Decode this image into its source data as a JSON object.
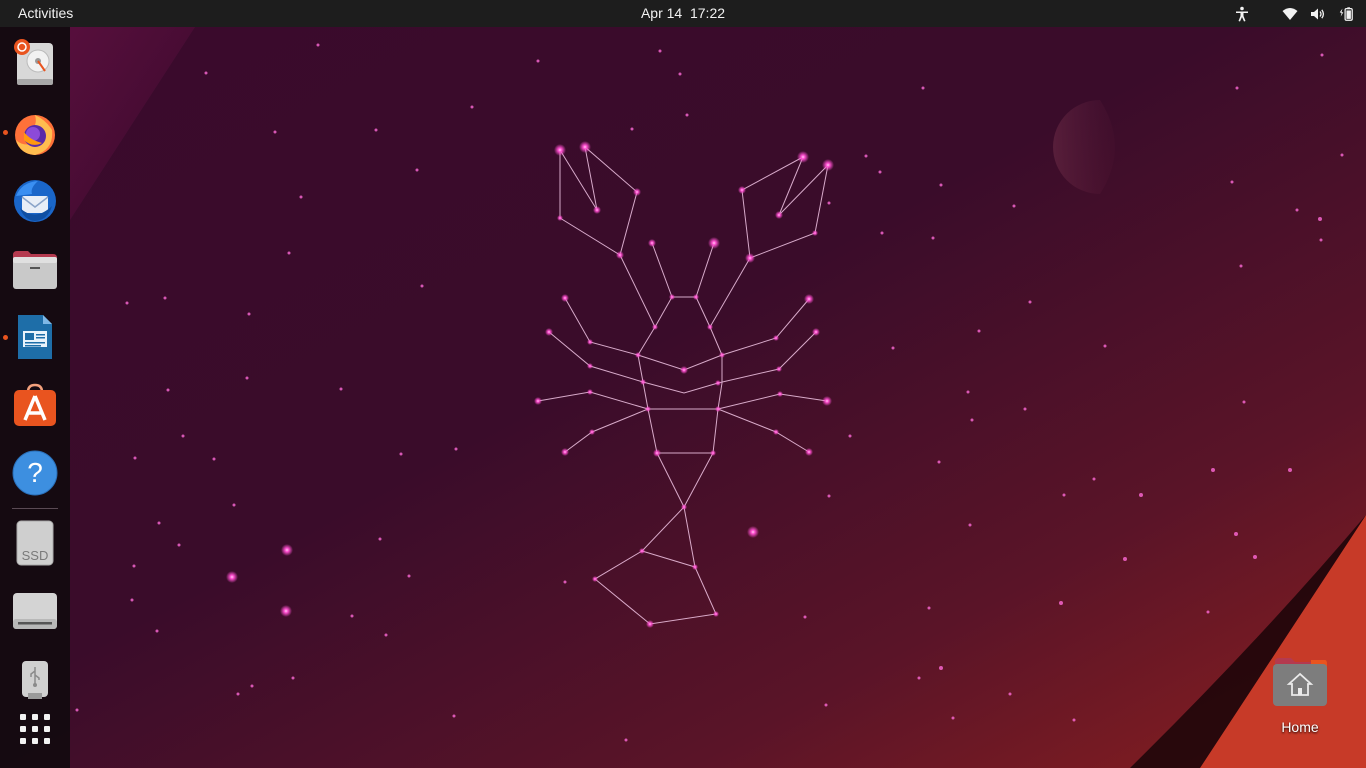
{
  "topbar": {
    "activities_label": "Activities",
    "date": "Apr 14",
    "time": "17:22",
    "tray_icons": [
      "accessibility-icon",
      "wifi-icon",
      "volume-icon",
      "battery-icon"
    ]
  },
  "dock": {
    "items": [
      {
        "name": "disk-utility",
        "icon": "disk-utility-icon",
        "running": false
      },
      {
        "name": "firefox",
        "icon": "firefox-icon",
        "running": true
      },
      {
        "name": "thunderbird",
        "icon": "thunderbird-icon",
        "running": false
      },
      {
        "name": "files",
        "icon": "files-icon",
        "running": false
      },
      {
        "name": "libreoffice-writer",
        "icon": "writer-icon",
        "running": true
      },
      {
        "name": "ubuntu-software",
        "icon": "software-icon",
        "running": false
      },
      {
        "name": "help",
        "icon": "help-icon",
        "running": false,
        "glyph": "?"
      },
      {
        "name": "ssd-drive",
        "icon": "ssd-drive-icon",
        "running": false,
        "label": "SSD"
      },
      {
        "name": "removable-drive",
        "icon": "drive-icon",
        "running": false
      },
      {
        "name": "usb-drive",
        "icon": "usb-drive-icon",
        "running": false
      },
      {
        "name": "show-applications",
        "icon": "app-grid-icon",
        "running": false
      }
    ]
  },
  "desktop": {
    "home_label": "Home"
  },
  "colors": {
    "topbar": "#1d1d1d",
    "dock": "#100a0e",
    "accent": "#e9541f",
    "star": "#ff4fd0"
  }
}
